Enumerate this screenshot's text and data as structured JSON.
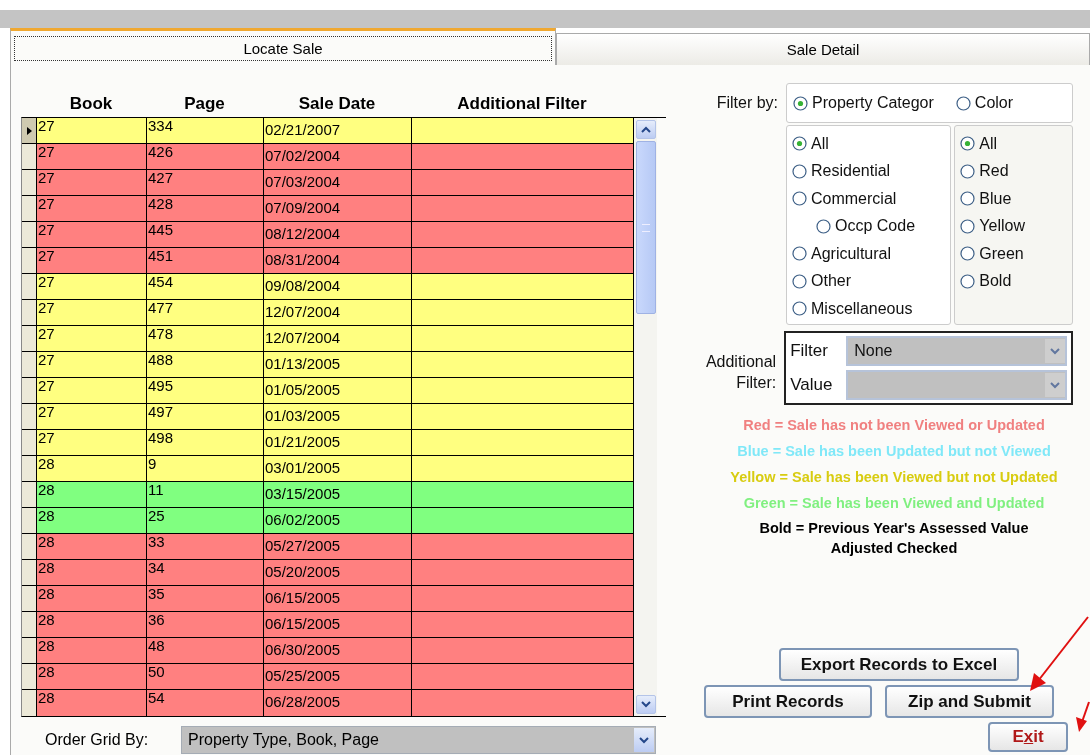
{
  "tabs": [
    {
      "label": "Locate Sale",
      "selected": true
    },
    {
      "label": "Sale Detail",
      "selected": false
    }
  ],
  "grid": {
    "columns": [
      "Book",
      "Page",
      "Sale Date",
      "Additional Filter"
    ],
    "rows": [
      {
        "book": "27",
        "page": "334",
        "sale_date": "02/21/2007",
        "color": "#ffff80",
        "selected": true
      },
      {
        "book": "27",
        "page": "426",
        "sale_date": "07/02/2004",
        "color": "#ff8080",
        "selected": false
      },
      {
        "book": "27",
        "page": "427",
        "sale_date": "07/03/2004",
        "color": "#ff8080",
        "selected": false
      },
      {
        "book": "27",
        "page": "428",
        "sale_date": "07/09/2004",
        "color": "#ff8080",
        "selected": false
      },
      {
        "book": "27",
        "page": "445",
        "sale_date": "08/12/2004",
        "color": "#ff8080",
        "selected": false
      },
      {
        "book": "27",
        "page": "451",
        "sale_date": "08/31/2004",
        "color": "#ff8080",
        "selected": false
      },
      {
        "book": "27",
        "page": "454",
        "sale_date": "09/08/2004",
        "color": "#ffff80",
        "selected": false
      },
      {
        "book": "27",
        "page": "477",
        "sale_date": "12/07/2004",
        "color": "#ffff80",
        "selected": false
      },
      {
        "book": "27",
        "page": "478",
        "sale_date": "12/07/2004",
        "color": "#ffff80",
        "selected": false
      },
      {
        "book": "27",
        "page": "488",
        "sale_date": "01/13/2005",
        "color": "#ffff80",
        "selected": false
      },
      {
        "book": "27",
        "page": "495",
        "sale_date": "01/05/2005",
        "color": "#ffff80",
        "selected": false
      },
      {
        "book": "27",
        "page": "497",
        "sale_date": "01/03/2005",
        "color": "#ffff80",
        "selected": false
      },
      {
        "book": "27",
        "page": "498",
        "sale_date": "01/21/2005",
        "color": "#ffff80",
        "selected": false
      },
      {
        "book": "28",
        "page": "9",
        "sale_date": "03/01/2005",
        "color": "#ffff80",
        "selected": false
      },
      {
        "book": "28",
        "page": "11",
        "sale_date": "03/15/2005",
        "color": "#80ff80",
        "selected": false
      },
      {
        "book": "28",
        "page": "25",
        "sale_date": "06/02/2005",
        "color": "#80ff80",
        "selected": false
      },
      {
        "book": "28",
        "page": "33",
        "sale_date": "05/27/2005",
        "color": "#ff8080",
        "selected": false
      },
      {
        "book": "28",
        "page": "34",
        "sale_date": "05/20/2005",
        "color": "#ff8080",
        "selected": false
      },
      {
        "book": "28",
        "page": "35",
        "sale_date": "06/15/2005",
        "color": "#ff8080",
        "selected": false
      },
      {
        "book": "28",
        "page": "36",
        "sale_date": "06/15/2005",
        "color": "#ff8080",
        "selected": false
      },
      {
        "book": "28",
        "page": "48",
        "sale_date": "06/30/2005",
        "color": "#ff8080",
        "selected": false
      },
      {
        "book": "28",
        "page": "50",
        "sale_date": "05/25/2005",
        "color": "#ff8080",
        "selected": false
      },
      {
        "book": "28",
        "page": "54",
        "sale_date": "06/28/2005",
        "color": "#ff8080",
        "selected": false
      }
    ]
  },
  "order_grid_by": {
    "label": "Order Grid By:",
    "value": "Property Type, Book, Page"
  },
  "filter_by": {
    "label": "Filter by:",
    "options": [
      {
        "label": "Property Categor",
        "selected": true
      },
      {
        "label": "Color",
        "selected": false
      }
    ]
  },
  "property_categories": [
    {
      "label": "All",
      "selected": true
    },
    {
      "label": "Residential",
      "selected": false
    },
    {
      "label": "Commercial",
      "selected": false,
      "children": [
        {
          "label": "Occp Code",
          "selected": false
        }
      ]
    },
    {
      "label": "Agricultural",
      "selected": false
    },
    {
      "label": "Other",
      "selected": false
    },
    {
      "label": "Miscellaneous",
      "selected": false
    }
  ],
  "colors": [
    {
      "label": "All",
      "selected": true
    },
    {
      "label": "Red",
      "selected": false
    },
    {
      "label": "Blue",
      "selected": false
    },
    {
      "label": "Yellow",
      "selected": false
    },
    {
      "label": "Green",
      "selected": false
    },
    {
      "label": "Bold",
      "selected": false
    }
  ],
  "additional_filter": {
    "label": "Additional Filter:",
    "fields": [
      {
        "label": "Filter",
        "value": "None",
        "disabled": true
      },
      {
        "label": "Value",
        "disabled": true
      }
    ]
  },
  "legend": [
    {
      "text": "Red = Sale has not been Viewed or Updated",
      "color": "#f08080"
    },
    {
      "text": "Blue = Sale has been Updated but not Viewed",
      "color": "#80e8f8"
    },
    {
      "text": "Yellow = Sale has been Viewed but not Updated",
      "color": "#d8cc10"
    },
    {
      "text": "Green = Sale has been Viewed and Updated",
      "color": "#80f080"
    },
    {
      "text": "Bold = Previous Year's Assessed Value Adjusted Checked",
      "color": "#000000"
    }
  ],
  "buttons": [
    {
      "label": "Export Records to Excel"
    },
    {
      "label": "Print Records"
    },
    {
      "label": "Zip and Submit"
    }
  ],
  "exit_button": {
    "label_start": "E",
    "hotkey": "x",
    "label_end": "it"
  },
  "annotations": [
    {
      "kind": "arrow"
    },
    {
      "kind": "arrow"
    }
  ]
}
